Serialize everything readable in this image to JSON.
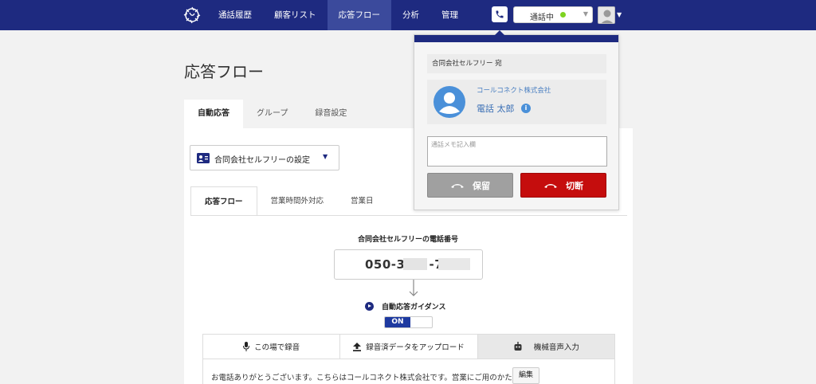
{
  "nav": {
    "items": [
      "通話履歴",
      "顧客リスト",
      "応答フロー",
      "分析",
      "管理"
    ],
    "active_index": 2
  },
  "status": {
    "label": "通話中",
    "dot_color": "#7ed321"
  },
  "page": {
    "title": "応答フロー",
    "tabs": [
      "自動応答",
      "グループ",
      "録音設定"
    ],
    "setting_select": "合同会社セルフリーの設定",
    "subtabs": [
      "応答フロー",
      "営業時間外対応",
      "営業日"
    ],
    "phone_title": "合同会社セルフリーの電話番号",
    "phone_number_visible": "050-3",
    "phone_number_visible2": "-7",
    "guidance_label": "自動応答ガイダンス",
    "toggle_label": "ON",
    "record_tabs": [
      "この場で録音",
      "録音済データをアップロード",
      "機械音声入力"
    ],
    "message": "お電話ありがとうございます。こちらはコールコネクト株式会社です。営業にご用のかた...",
    "edit_label": "編集"
  },
  "popup": {
    "destination": "合同会社セルフリー 宛",
    "company": "コールコネクト株式会社",
    "name": "電話 太郎",
    "memo_placeholder": "通話メモ記入欄",
    "hold_label": "保留",
    "hangup_label": "切断"
  },
  "colors": {
    "brand": "#1e2a80",
    "hangup": "#c50d0d",
    "hold": "#a0a0a0"
  }
}
